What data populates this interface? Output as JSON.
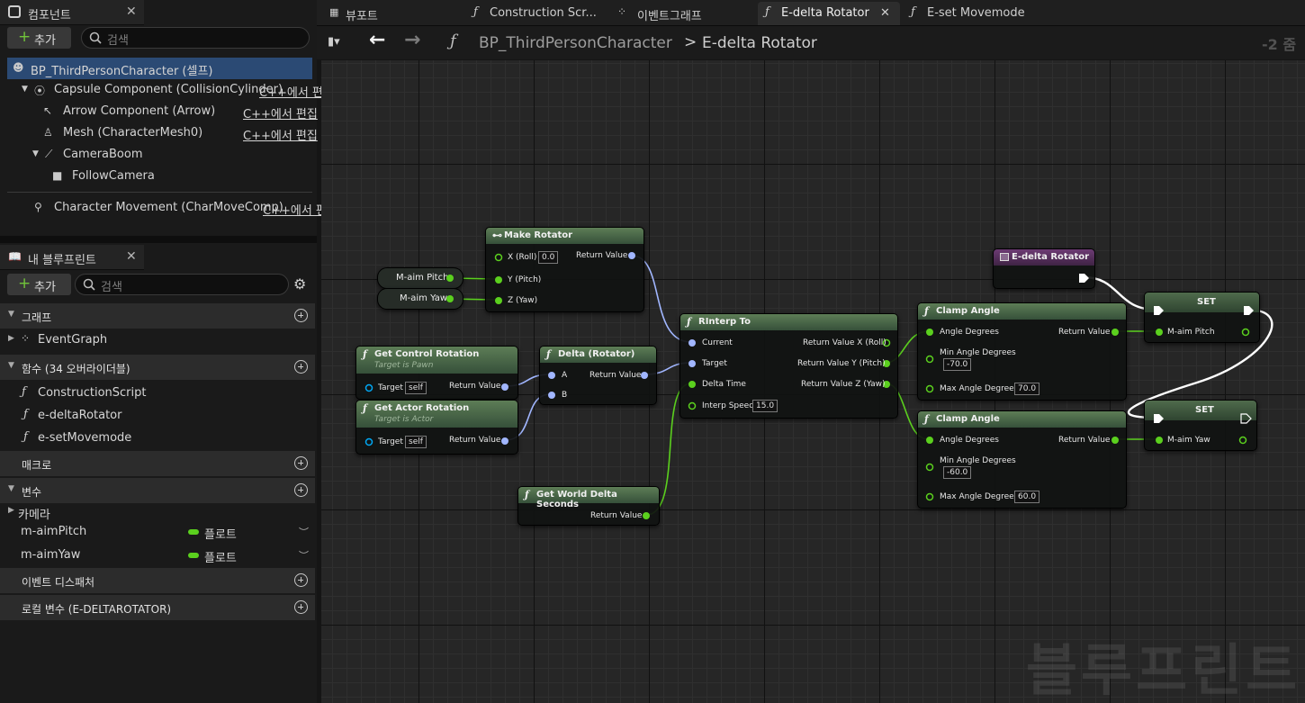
{
  "components_panel": {
    "tab": "컴포넌트",
    "add_label": "추가",
    "search_placeholder": "검색",
    "self_item": "BP_ThirdPersonCharacter (셀프)",
    "items": [
      {
        "label": "Capsule Component (CollisionCylinder)",
        "edit": "C++에서 편"
      },
      {
        "label": "Arrow Component (Arrow)",
        "edit": "C++에서 편집"
      },
      {
        "label": "Mesh (CharacterMesh0)",
        "edit": "C++에서 편집"
      },
      {
        "label": "CameraBoom",
        "edit": ""
      },
      {
        "label": "FollowCamera",
        "edit": ""
      },
      {
        "label": "Character Movement (CharMoveComp)",
        "edit": "C++에서 편"
      }
    ]
  },
  "blueprint_panel": {
    "tab": "내 블루프린트",
    "add_label": "추가",
    "search_placeholder": "검색",
    "graphs_label": "그래프",
    "event_graph": "EventGraph",
    "functions_label": "함수 (34 오버라이더블)",
    "functions": [
      "ConstructionScript",
      "e-deltaRotator",
      "e-setMovemode"
    ],
    "macros_label": "매크로",
    "variables_label": "변수",
    "var_category": "카메라",
    "variables": [
      {
        "name": "m-aimPitch",
        "type": "플로트"
      },
      {
        "name": "m-aimYaw",
        "type": "플로트"
      }
    ],
    "dispatchers_label": "이벤트 디스패처",
    "locals_label": "로컬 변수 (E-DELTAROTATOR)"
  },
  "doc_tabs": [
    {
      "label": "뷰포트",
      "icon": "viewport-icon"
    },
    {
      "label": "Construction Scr...",
      "icon": "function-icon"
    },
    {
      "label": "이벤트그래프",
      "icon": "event-graph-icon"
    },
    {
      "label": "E-delta Rotator",
      "icon": "function-icon",
      "active": true
    },
    {
      "label": "E-set Movemode",
      "icon": "function-icon"
    }
  ],
  "breadcrumb": {
    "root": "BP_ThirdPersonCharacter",
    "sep": ">",
    "leaf": "E-delta Rotator"
  },
  "zoom": "-2 줌",
  "watermark": "블루프린트",
  "colors": {
    "float_pin": "#5bd01e",
    "struct_pin": "#a1b6ff",
    "object_pin": "#00a8f4",
    "selection": "#2b4a74"
  },
  "nodes": {
    "make_rotator": {
      "title": "Make Rotator",
      "x_label": "X (Roll)",
      "x_val": "0.0",
      "y_label": "Y (Pitch)",
      "z_label": "Z (Yaw)",
      "out": "Return Value"
    },
    "aim_pitch": "M-aim Pitch",
    "aim_yaw": "M-aim Yaw",
    "get_control_rotation": {
      "title": "Get Control Rotation",
      "sub": "Target is Pawn",
      "target": "Target",
      "self": "self",
      "out": "Return Value"
    },
    "get_actor_rotation": {
      "title": "Get Actor Rotation",
      "sub": "Target is Actor",
      "target": "Target",
      "self": "self",
      "out": "Return Value"
    },
    "delta_rotator": {
      "title": "Delta (Rotator)",
      "a": "A",
      "b": "B",
      "out": "Return Value"
    },
    "rinterp": {
      "title": "RInterp To",
      "current": "Current",
      "target": "Target",
      "delta": "Delta Time",
      "speed_label": "Interp Speed",
      "speed": "15.0",
      "rx": "Return Value X (Roll)",
      "ry": "Return Value Y (Pitch)",
      "rz": "Return Value Z (Yaw)"
    },
    "world_delta": {
      "title": "Get World Delta Seconds",
      "out": "Return Value"
    },
    "entry": {
      "title": "E-delta Rotator"
    },
    "clamp1": {
      "title": "Clamp Angle",
      "deg": "Angle Degrees",
      "min_label": "Min Angle Degrees",
      "min": "-70.0",
      "max_label": "Max Angle Degrees",
      "max": "70.0",
      "out": "Return Value"
    },
    "clamp2": {
      "title": "Clamp Angle",
      "deg": "Angle Degrees",
      "min_label": "Min Angle Degrees",
      "min": "-60.0",
      "max_label": "Max Angle Degrees",
      "max": "60.0",
      "out": "Return Value"
    },
    "set1": {
      "title": "SET",
      "var": "M-aim Pitch"
    },
    "set2": {
      "title": "SET",
      "var": "M-aim Yaw"
    }
  }
}
